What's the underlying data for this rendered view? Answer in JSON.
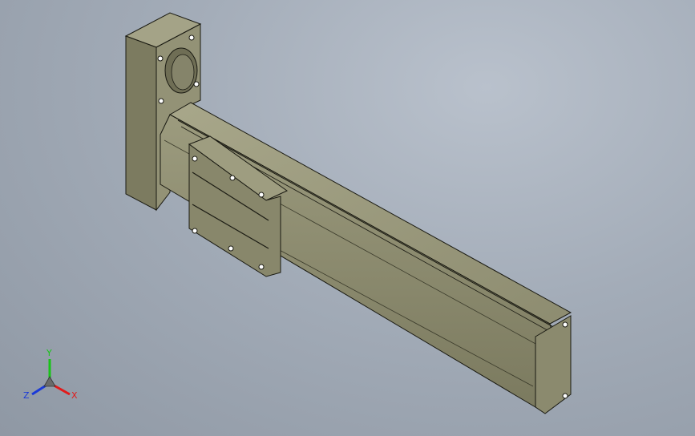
{
  "viewport": {
    "background_top": "#b9c1cc",
    "background_bottom": "#8f98a4"
  },
  "model": {
    "body_color": "#8a8a6c",
    "body_light": "#a3a285",
    "body_dark": "#5c5c45",
    "edge_color": "#1a1a12"
  },
  "triad": {
    "axis_x": {
      "label": "X",
      "color": "#e21a1a"
    },
    "axis_y": {
      "label": "Y",
      "color": "#18c418"
    },
    "axis_z": {
      "label": "Z",
      "color": "#1a3ad8"
    }
  }
}
